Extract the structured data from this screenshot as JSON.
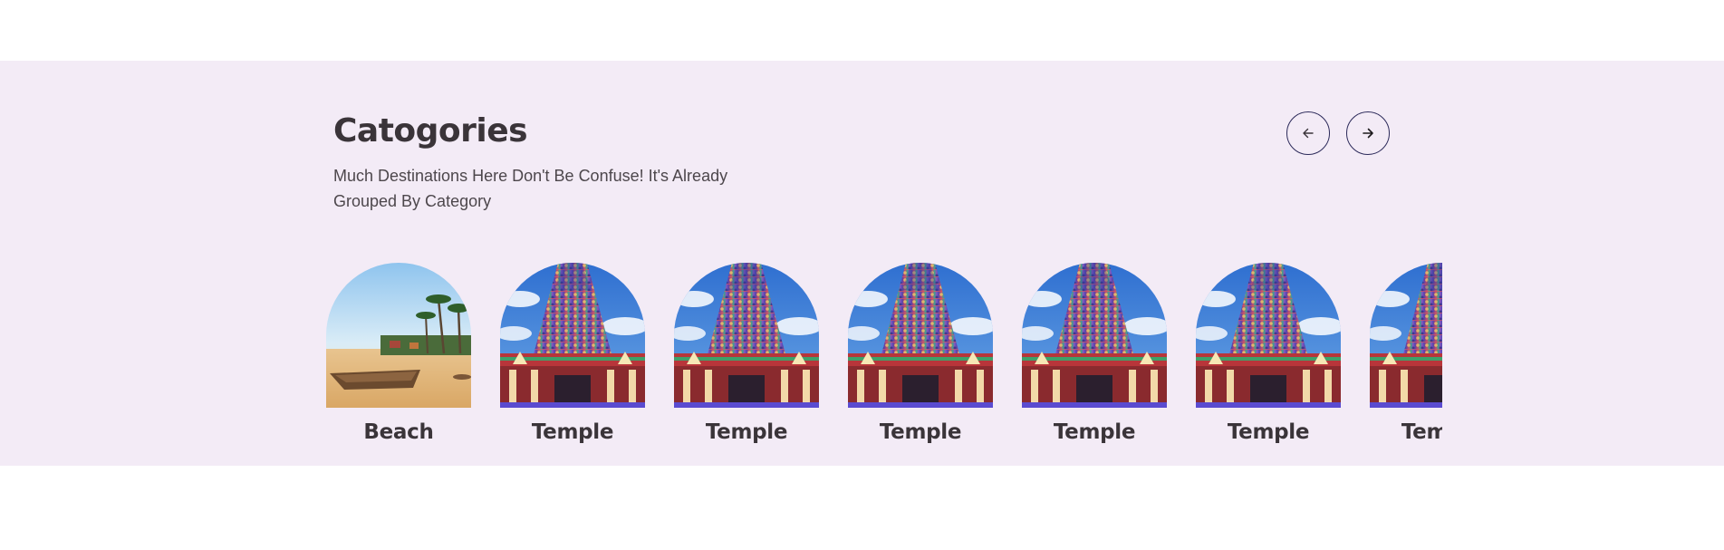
{
  "section": {
    "title": "Catogories",
    "subtitle": "Much Destinations Here Don't Be Confuse! It's Already Grouped By Category",
    "background": "#f3ebf6"
  },
  "nav": {
    "prev_icon": "arrow-left-icon",
    "next_icon": "arrow-right-icon",
    "border_color": "#2c2a5a"
  },
  "categories": [
    {
      "label": "Beach",
      "image": "beach-photo"
    },
    {
      "label": "Temple",
      "image": "temple-photo"
    },
    {
      "label": "Temple",
      "image": "temple-photo"
    },
    {
      "label": "Temple",
      "image": "temple-photo"
    },
    {
      "label": "Temple",
      "image": "temple-photo"
    },
    {
      "label": "Temple",
      "image": "temple-photo"
    },
    {
      "label": "Temple",
      "image": "temple-photo"
    }
  ]
}
